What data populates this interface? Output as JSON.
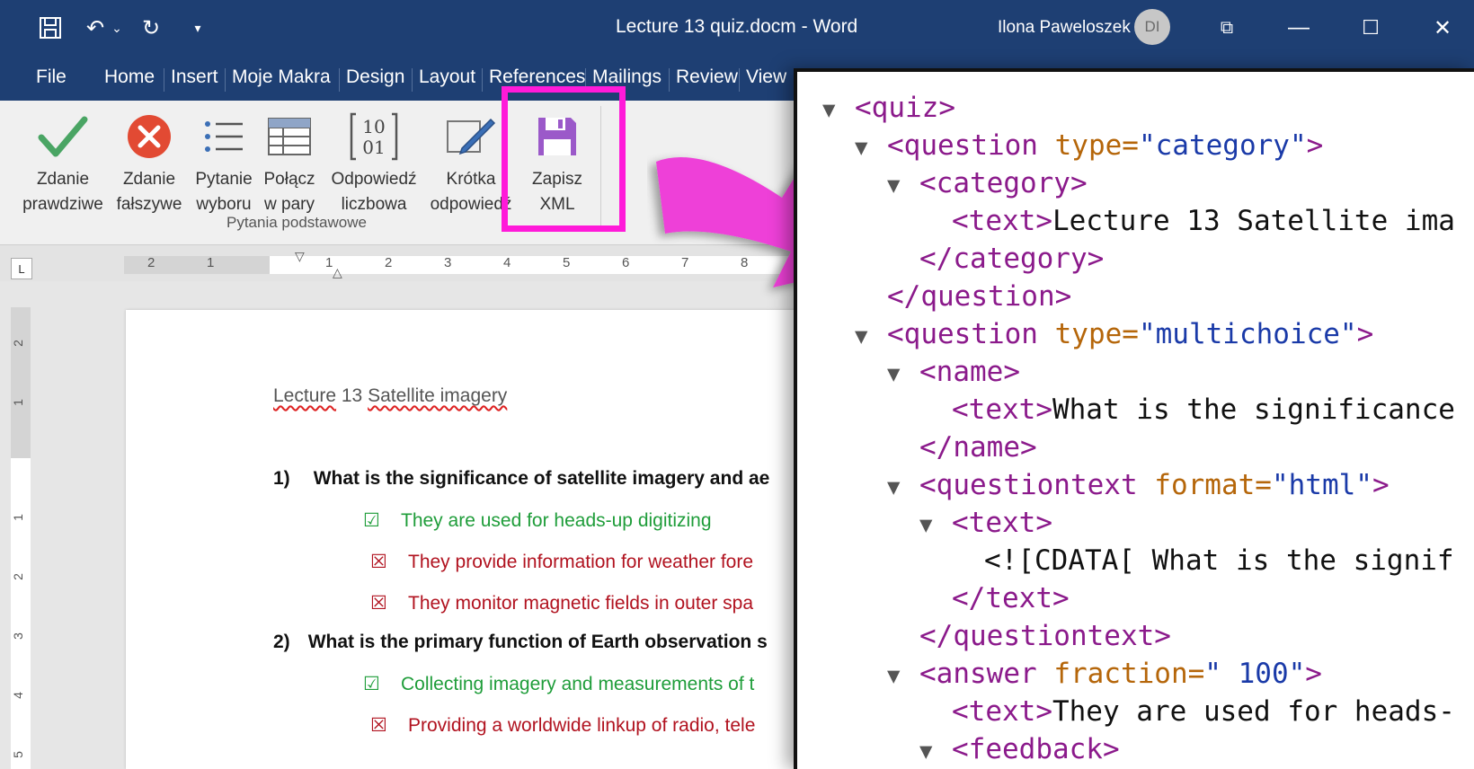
{
  "titlebar": {
    "document_title": "Lecture 13 quiz.docm - Word",
    "user_name": "Ilona Paweloszek",
    "avatar_initials": "DI",
    "quick_access": [
      "save-icon",
      "undo-icon",
      "redo-icon",
      "customize-icon"
    ],
    "window_buttons": [
      "ribbon-display-icon",
      "minimize-icon",
      "maximize-icon",
      "close-icon"
    ]
  },
  "menu": {
    "items": [
      "File",
      "Home",
      "Insert",
      "Moje Makra",
      "Design",
      "Layout",
      "References",
      "Mailings",
      "Review",
      "View"
    ]
  },
  "ribbon": {
    "buttons": [
      {
        "line1": "Zdanie",
        "line2": "prawdziwe",
        "icon": "checkmark-icon"
      },
      {
        "line1": "Zdanie",
        "line2": "fałszywe",
        "icon": "cross-circle-icon"
      },
      {
        "line1": "Pytanie",
        "line2": "wyboru",
        "icon": "list-icon"
      },
      {
        "line1": "Połącz",
        "line2": "w pary",
        "icon": "table-icon"
      },
      {
        "line1": "Odpowiedź",
        "line2": "liczbowa",
        "icon": "binary-icon"
      },
      {
        "line1": "Krótka",
        "line2": "odpowiedź",
        "icon": "pencil-icon"
      },
      {
        "line1": "Zapisz",
        "line2": "XML",
        "icon": "floppy-disk-icon"
      }
    ],
    "group_label": "Pytania podstawowe",
    "accent_color": "#ff1ad9"
  },
  "ruler": {
    "numbers": [
      "2",
      "1",
      "1",
      "2",
      "3",
      "4",
      "5",
      "6",
      "7",
      "8"
    ],
    "vertical_numbers": [
      "2",
      "1",
      "1",
      "2",
      "3",
      "4",
      "5"
    ]
  },
  "document": {
    "heading_parts": [
      "Lecture",
      " 13 ",
      "Satellite imagery"
    ],
    "questions": [
      {
        "label": "1)",
        "text": "What is the significance of satellite imagery and ae",
        "answers": [
          {
            "correct": true,
            "text": "They are used for heads-up digitizing"
          },
          {
            "correct": false,
            "text": "They provide information for weather fore"
          },
          {
            "correct": false,
            "text": "They monitor magnetic fields in outer spa"
          }
        ]
      },
      {
        "label": "2)",
        "text": "What is the primary function of Earth observation s",
        "answers": [
          {
            "correct": true,
            "text": "Collecting imagery and measurements of t"
          },
          {
            "correct": false,
            "text": "Providing a worldwide linkup of radio, tele"
          }
        ]
      }
    ],
    "marks": {
      "correct": "☑",
      "wrong": "☒"
    }
  },
  "xml": {
    "quiz_open": "<quiz>",
    "q1_tag": "<question",
    "q1_attr": " type=",
    "q1_val": "\"category\"",
    "q1_close": ">",
    "category_open": "<category>",
    "text1_tag": "<text>",
    "text1_value": "Lecture 13 Satellite ima",
    "category_close": "</category>",
    "question_close": "</question>",
    "q2_tag": "<question",
    "q2_attr": " type=",
    "q2_val": "\"multichoice\"",
    "q2_close": ">",
    "name_open": "<name>",
    "text2_tag": "<text>",
    "text2_value": "What is the significance",
    "name_close": "</name>",
    "qt_tag": "<questiontext",
    "qt_attr": " format=",
    "qt_val": "\"html\"",
    "qt_close": ">",
    "text_open": "<text>",
    "cdata": "<![CDATA[ What is the signif",
    "text_close": "</text>",
    "qt_end": "</questiontext>",
    "ans_tag": "<answer",
    "ans_attr": " fraction=",
    "ans_val_q": "\" 100\"",
    "ans_close": ">",
    "text3_tag": "<text>",
    "text3_value": "They are used for heads-",
    "feedback_open": "<feedback>"
  }
}
